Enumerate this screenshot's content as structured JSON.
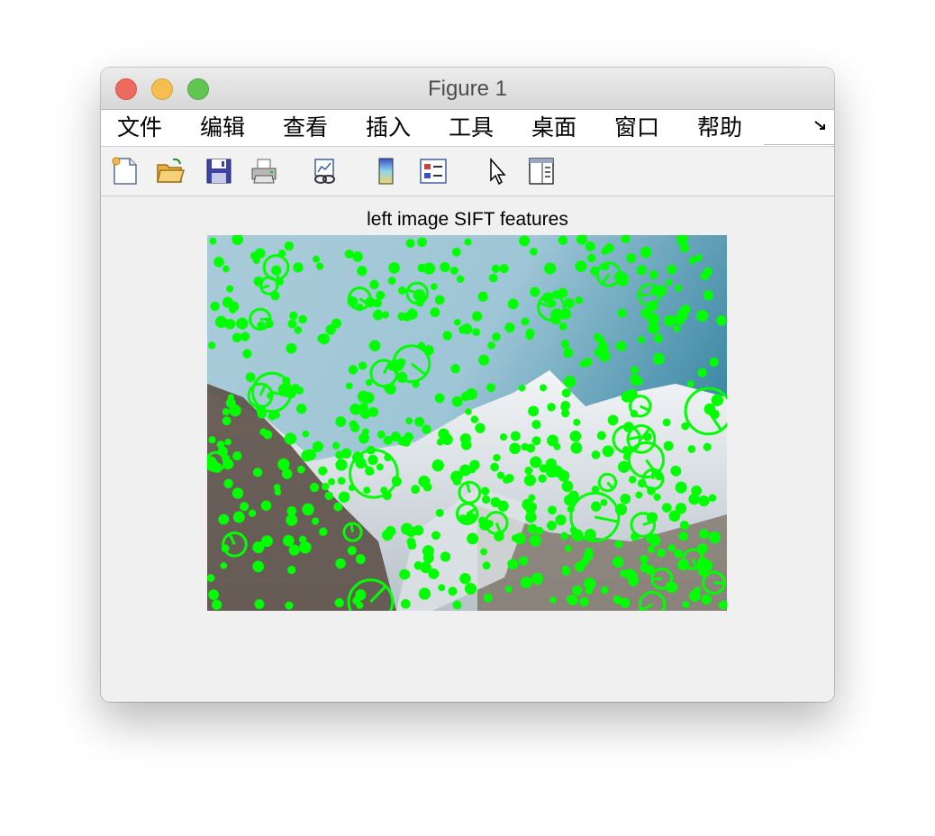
{
  "window": {
    "title": "Figure 1",
    "traffic_lights": [
      "close",
      "minimize",
      "zoom"
    ]
  },
  "menubar": {
    "items": [
      "文件",
      "编辑",
      "查看",
      "插入",
      "工具",
      "桌面",
      "窗口",
      "帮助"
    ],
    "overflow_icon": "corner-arrow-icon"
  },
  "toolbar": {
    "icons": [
      "new-figure-icon",
      "open-file-icon",
      "save-icon",
      "print-icon",
      "link-plot-icon",
      "colorbar-icon",
      "legend-icon",
      "pointer-icon",
      "property-editor-icon"
    ]
  },
  "axes": {
    "title": "left image SIFT features",
    "image_subject": "snow-capped mountain range under blue sky",
    "marker_color": "#00ff00",
    "marker_meaning": "SIFT keypoints drawn as circles with orientation lines"
  }
}
